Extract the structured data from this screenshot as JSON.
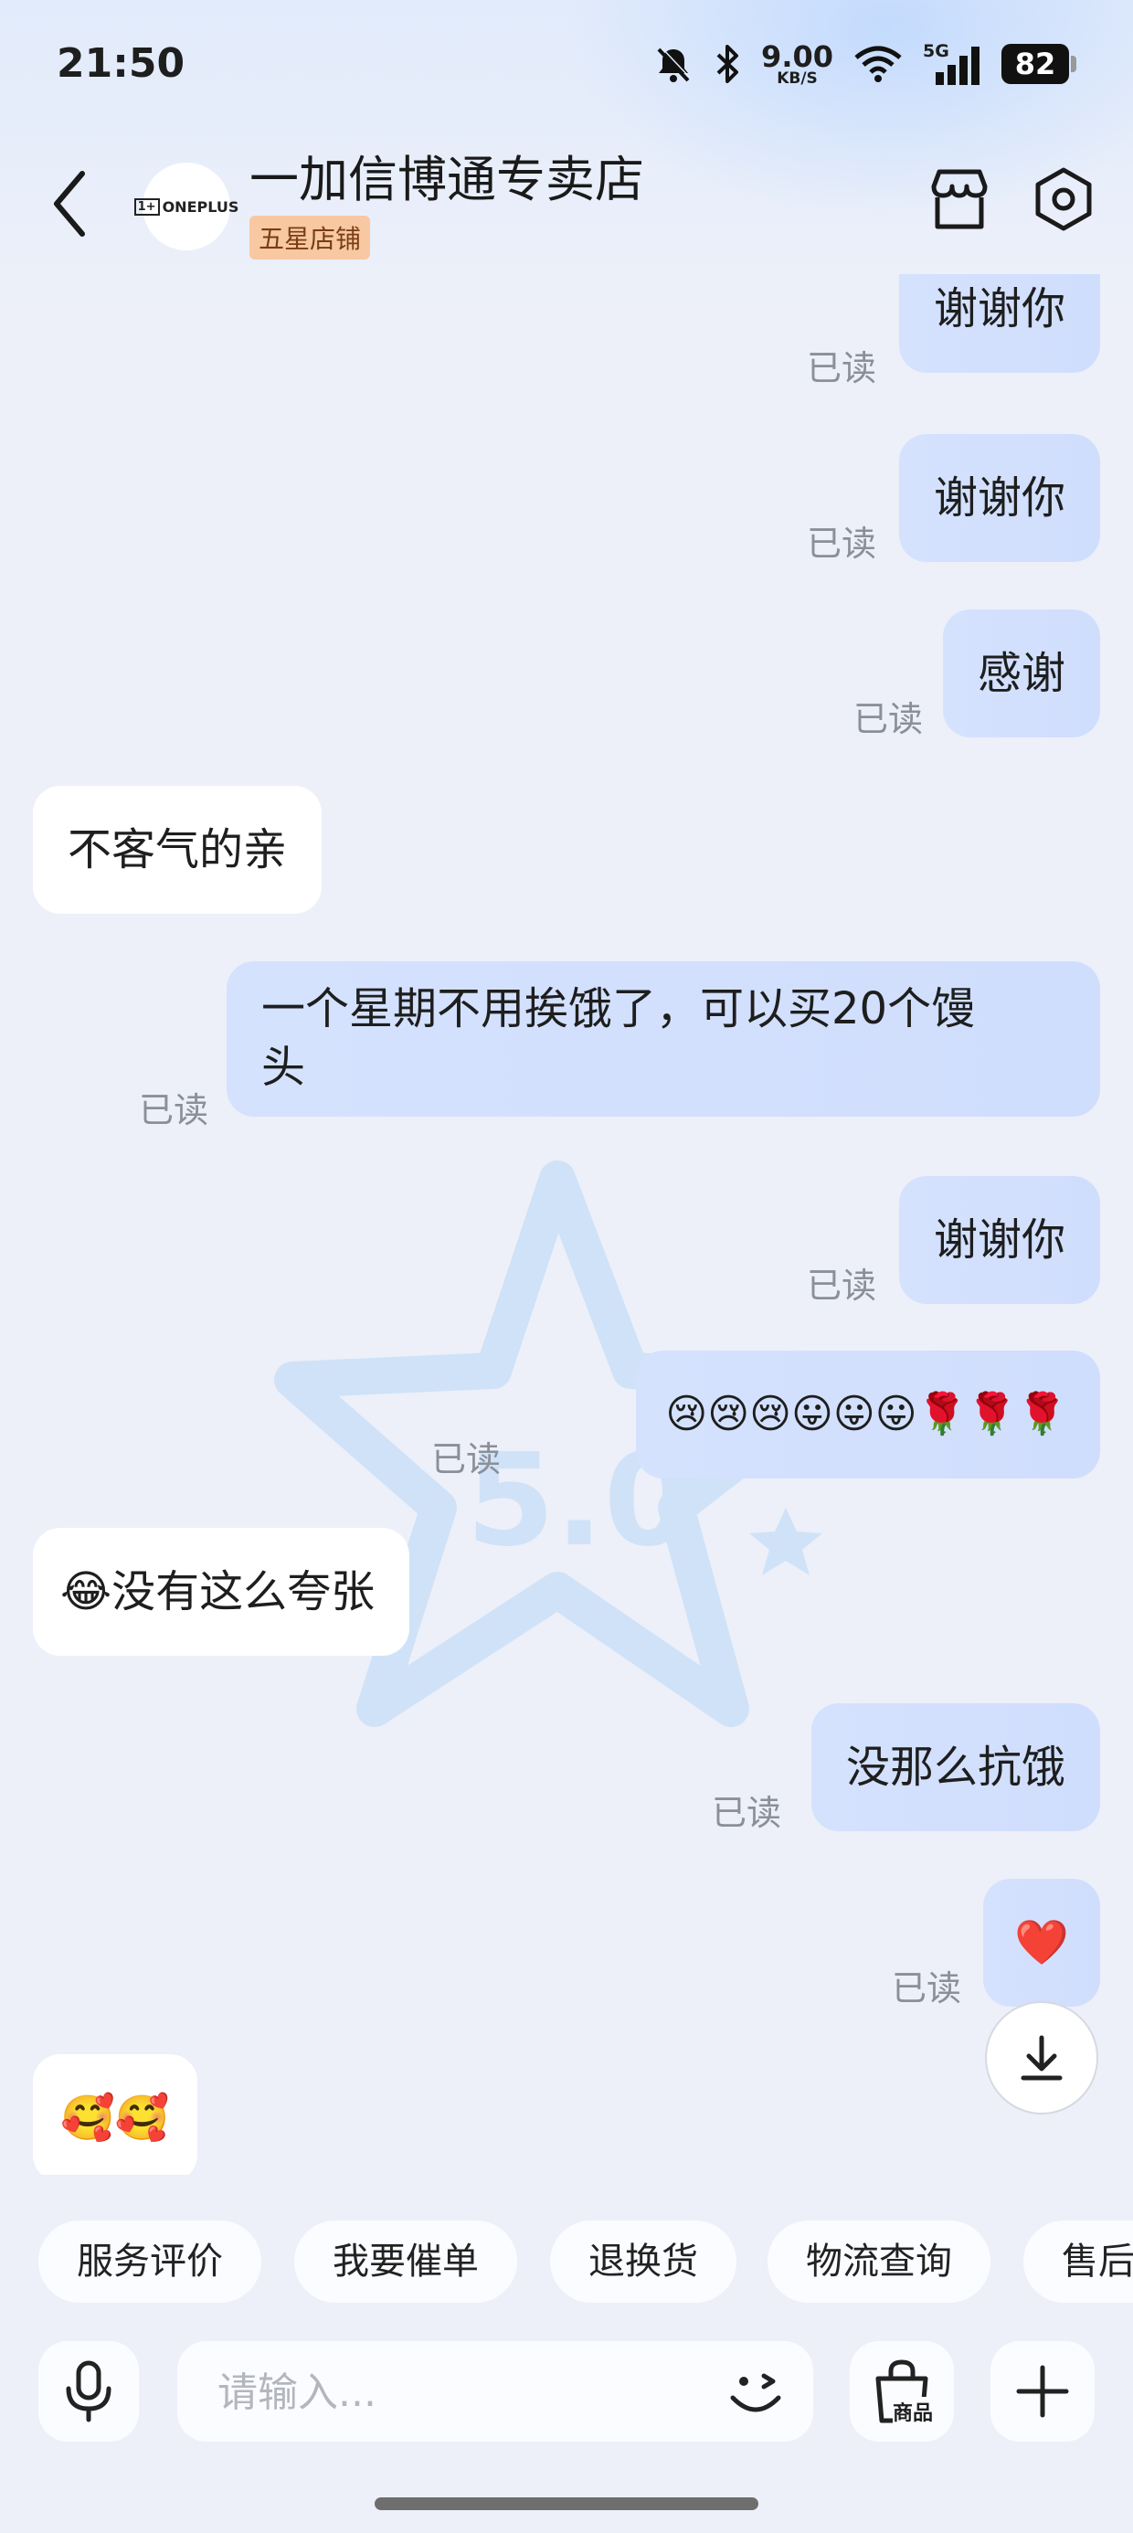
{
  "status_bar": {
    "time": "21:50",
    "net_speed_value": "9.00",
    "net_speed_unit": "KB/S",
    "network": "5G",
    "battery": "82",
    "icons": [
      "mute-bell-icon",
      "bluetooth-icon",
      "wifi-icon",
      "signal-icon",
      "battery-icon"
    ]
  },
  "header": {
    "shop_name": "一加信博通专卖店",
    "badge": "五星店铺",
    "avatar_text": "ONEPLUS",
    "avatar_mark": "1+"
  },
  "messages": [
    {
      "side": "me",
      "text": "谢谢你",
      "status": "已读"
    },
    {
      "side": "me",
      "text": "谢谢你",
      "status": "已读"
    },
    {
      "side": "me",
      "text": "感谢",
      "status": "已读"
    },
    {
      "side": "them",
      "text": "不客气的亲"
    },
    {
      "side": "me",
      "text": "一个星期不用挨饿了，可以买20个馒\n头",
      "status": "已读"
    },
    {
      "side": "me",
      "text": "谢谢你",
      "status": "已读"
    },
    {
      "side": "me",
      "text": "😢😢😢😛😛😛🌹🌹🌹",
      "status": "已读"
    },
    {
      "side": "them",
      "text": "😂没有这么夸张"
    },
    {
      "side": "me",
      "text": "没那么抗饿",
      "status": "已读"
    },
    {
      "side": "me",
      "text": "❤️",
      "status": "已读"
    },
    {
      "side": "them",
      "text": "🥰🥰"
    }
  ],
  "quick_replies": [
    "服务评价",
    "我要催单",
    "退换货",
    "物流查询",
    "售后"
  ],
  "input": {
    "placeholder": "请输入...",
    "value": ""
  },
  "product_button_label": "商品",
  "colors": {
    "my_bubble": "#d2e0fd",
    "their_bubble": "#ffffff",
    "background": "#edf0f9",
    "read_status": "#8a8f99",
    "badge_bg": "#f7c8a2"
  }
}
